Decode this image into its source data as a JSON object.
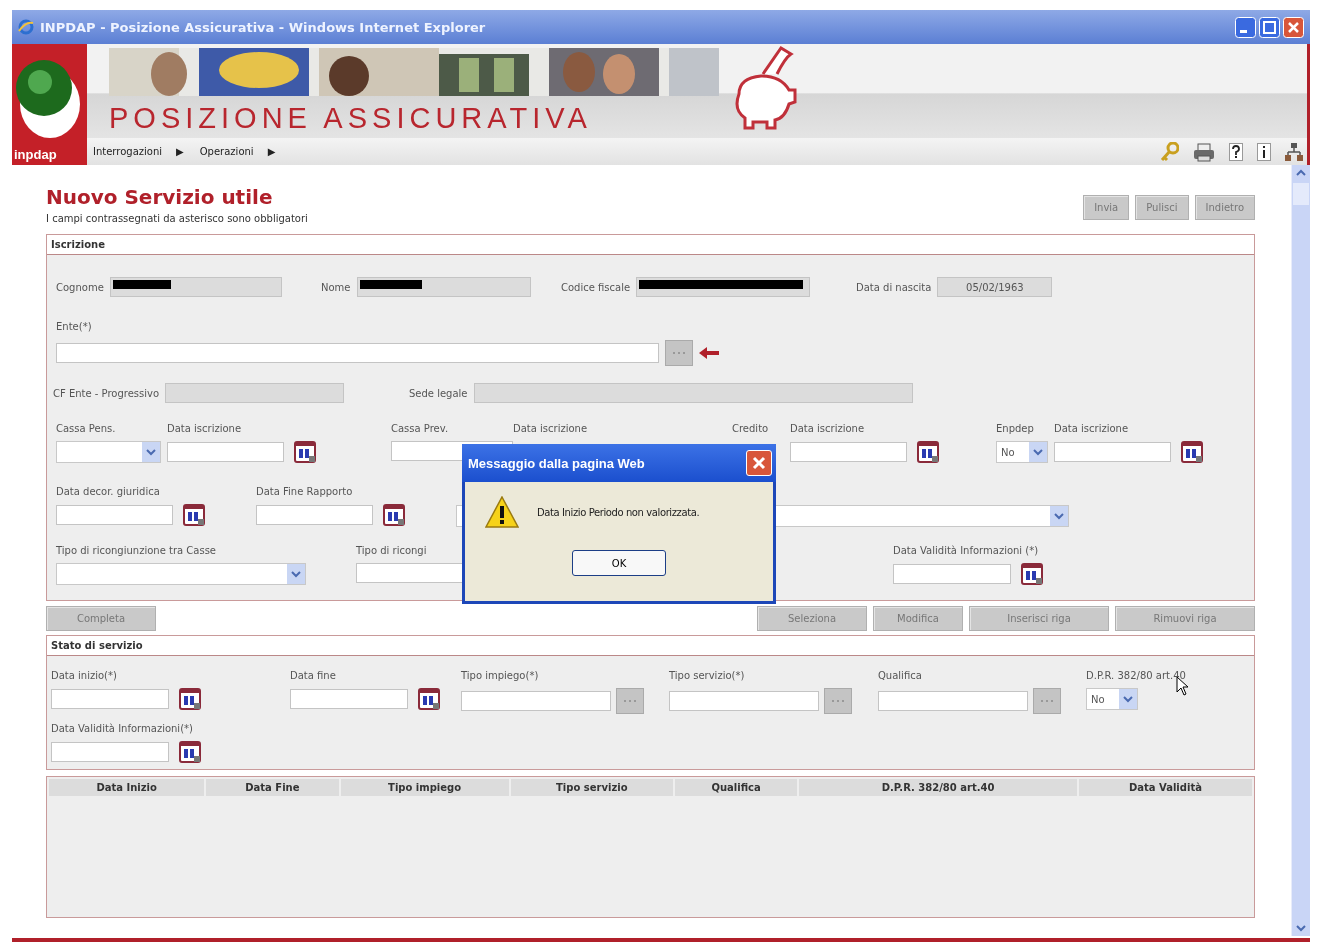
{
  "window": {
    "title": "INPDAP - Posizione Assicurativa - Windows Internet Explorer"
  },
  "banner": {
    "logo_text": "inpdap",
    "title": "POSIZIONE ASSICURATIVA"
  },
  "menu": [
    {
      "label": "Interrogazioni",
      "arrow": "▶"
    },
    {
      "label": "Operazioni",
      "arrow": "▶"
    }
  ],
  "page": {
    "title": "Nuovo Servizio utile",
    "subtitle": "I campi contrassegnati da asterisco sono obbligatori",
    "buttons": [
      "Invia",
      "Pulisci",
      "Indietro"
    ]
  },
  "iscrizione": {
    "title": "Iscrizione",
    "anagrafica": [
      {
        "label": "Cognome",
        "redacted": true
      },
      {
        "label": "Nome",
        "redacted": true
      },
      {
        "label": "Codice fiscale",
        "redacted": true
      },
      {
        "label": "Data di nascita",
        "redacted": false,
        "value": "05/02/1963"
      }
    ],
    "ente": {
      "label": "Ente(*)"
    },
    "cf_row": [
      {
        "label": "CF Ente - Progressivo"
      },
      {
        "label": "Sede legale"
      }
    ],
    "lines": [
      {
        "fields": [
          {
            "label": "Cassa Pens.",
            "kind": "select"
          },
          {
            "label": "Data iscrizione",
            "kind": "date"
          },
          {
            "label": "Cassa Prev.",
            "kind": "text"
          },
          {
            "label": "Data iscrizione"
          },
          {
            "label": "Credito"
          },
          {
            "label": "Data iscrizione",
            "kind": "date"
          },
          {
            "label": "Enpdep",
            "kind": "select",
            "value": "No"
          },
          {
            "label": "Data iscrizione",
            "kind": "date"
          }
        ]
      },
      {
        "fields": [
          {
            "label": "Data decor. giuridica",
            "kind": "date"
          },
          {
            "label": "Data Fine Rapporto",
            "kind": "date"
          },
          {
            "kind": "select"
          }
        ]
      },
      {
        "fields": [
          {
            "label": "Tipo di ricongiunzione tra Casse",
            "kind": "select"
          },
          {
            "label": "Tipo di ricongi",
            "kind": "text"
          },
          {
            "label": "Data Validità Informazioni (*)",
            "kind": "date"
          }
        ]
      }
    ]
  },
  "actions": {
    "left": [
      "Completa"
    ],
    "right": [
      "Seleziona",
      "Modifica",
      "Inserisci riga",
      "Rimuovi riga"
    ]
  },
  "stato": {
    "title": "Stato di servizio",
    "lines": [
      {
        "fields": [
          {
            "label": "Data inizio(*)",
            "kind": "date"
          },
          {
            "label": "Data fine",
            "kind": "date"
          },
          {
            "label": "Tipo impiego(*)",
            "kind": "lookup"
          },
          {
            "label": "Tipo servizio(*)",
            "kind": "lookup"
          },
          {
            "label": "Qualifica",
            "kind": "lookup"
          },
          {
            "label": "D.P.R. 382/80 art.40",
            "kind": "select",
            "value": "No"
          }
        ]
      },
      {
        "fields": [
          {
            "label": "Data Validità Informazioni(*)",
            "kind": "date"
          }
        ]
      }
    ]
  },
  "table": {
    "columns": [
      "Data Inizio",
      "Data Fine",
      "Tipo impiego",
      "Tipo servizio",
      "Qualifica",
      "D.P.R. 382/80 art.40",
      "Data Validità"
    ]
  },
  "dialog": {
    "title": "Messaggio dalla pagina Web",
    "message": "Data Inizio Periodo non valorizzata.",
    "button": "OK"
  }
}
